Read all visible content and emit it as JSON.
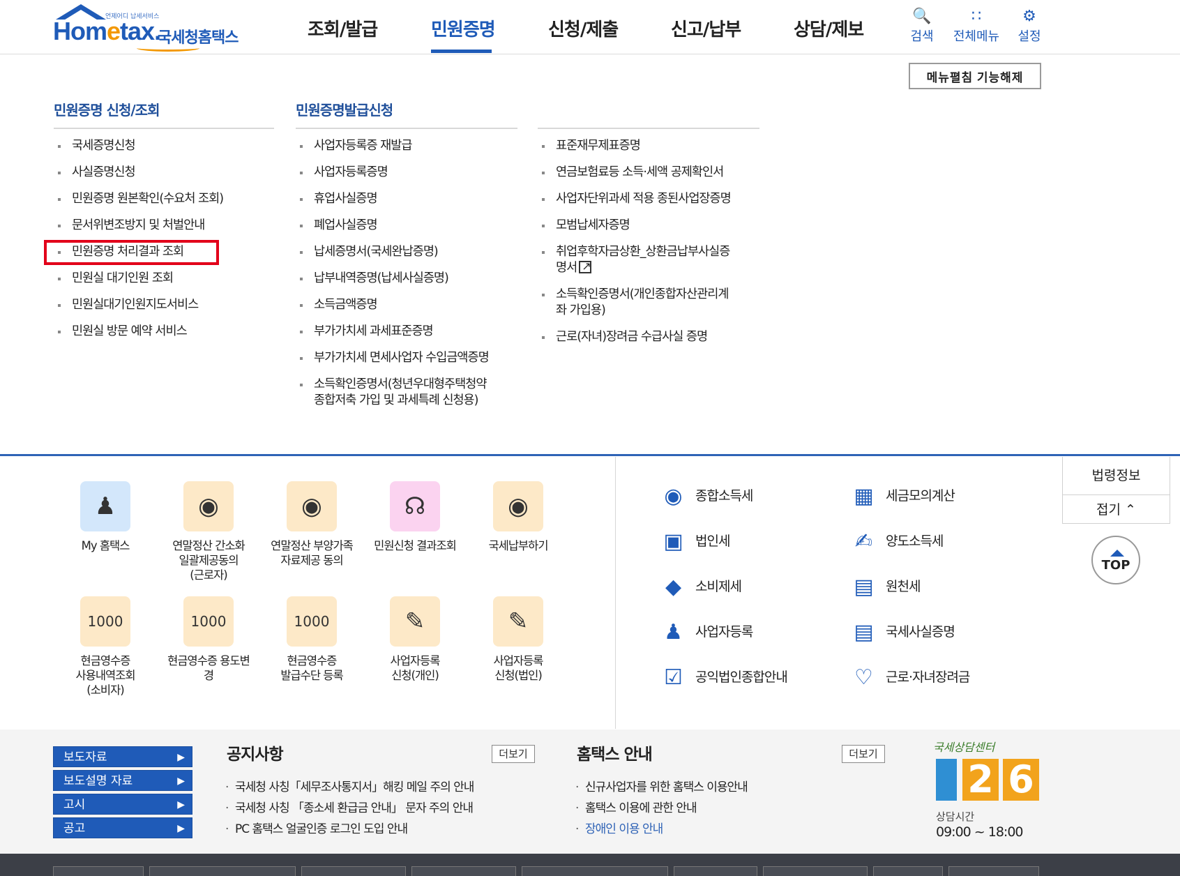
{
  "header": {
    "logo_tag": "언제어디 납세서비스",
    "logo_word_a": "Hom",
    "logo_word_b": "e",
    "logo_word_c": "tax",
    "logo_word_dot": ".",
    "logo_korean": "국세청홈택스",
    "nav": [
      {
        "label": "조회/발급",
        "active": false
      },
      {
        "label": "민원증명",
        "active": true
      },
      {
        "label": "신청/제출",
        "active": false
      },
      {
        "label": "신고/납부",
        "active": false
      },
      {
        "label": "상담/제보",
        "active": false
      }
    ],
    "utils": [
      {
        "label": "검색",
        "icon": "search-icon"
      },
      {
        "label": "전체메뉴",
        "icon": "grid-icon"
      },
      {
        "label": "설정",
        "icon": "gear-icon"
      }
    ],
    "fold_button": "메뉴펼침 기능해제"
  },
  "megamenu": {
    "col1_title": "민원증명 신청/조회",
    "col2_title": "민원증명발급신청",
    "col1": [
      "국세증명신청",
      "사실증명신청",
      "민원증명 원본확인(수요처 조회)",
      "문서위변조방지 및 처벌안내",
      "민원증명 처리결과 조회",
      "민원실 대기인원 조회",
      "민원실대기인원지도서비스",
      "민원실 방문 예약 서비스"
    ],
    "col2": [
      "사업자등록증 재발급",
      "사업자등록증명",
      "휴업사실증명",
      "폐업사실증명",
      "납세증명서(국세완납증명)",
      "납부내역증명(납세사실증명)",
      "소득금액증명",
      "부가가치세 과세표준증명",
      "부가가치세 면세사업자 수입금액증명",
      "소득확인증명서(청년우대형주택청약",
      "종합저축 가입 및 과세특례 신청용)"
    ],
    "col3": [
      "표준재무제표증명",
      "연금보험료등 소득·세액 공제확인서",
      "사업자단위과세 적용 종된사업장증명",
      "모범납세자증명",
      "취업후학자금상환_상환금납부사실증",
      "명서",
      "소득확인증명서(개인종합자산관리계",
      "좌 가입용)",
      "근로(자녀)장려금 수급사실 증명"
    ]
  },
  "quick": [
    {
      "label": "My 홈택스",
      "icon": "user-icon"
    },
    {
      "label": "연말정산 간소화 일괄제공동의 (근로자)",
      "icon": "moneybag-icon"
    },
    {
      "label": "연말정산 부양가족 자료제공 동의",
      "icon": "moneybag-icon"
    },
    {
      "label": "민원신청 결과조회",
      "icon": "headset-icon"
    },
    {
      "label": "국세납부하기",
      "icon": "moneybag-icon"
    },
    {
      "label": "현금영수증 사용내역조회 (소비자)",
      "icon": "receipt-icon"
    },
    {
      "label": "현금영수증 용도변경",
      "icon": "receipt-icon"
    },
    {
      "label": "현금영수증 발급수단 등록",
      "icon": "receipt-icon"
    },
    {
      "label": "사업자등록 신청(개인)",
      "icon": "register-icon"
    },
    {
      "label": "사업자등록 신청(법인)",
      "icon": "register-icon"
    }
  ],
  "quick_label_lines": [
    [
      "My 홈택스"
    ],
    [
      "연말정산 간소화",
      "일괄제공동의",
      "(근로자)"
    ],
    [
      "연말정산 부양가족",
      "자료제공 동의"
    ],
    [
      "민원신청 결과조회"
    ],
    [
      "국세납부하기"
    ],
    [
      "현금영수증",
      "사용내역조회",
      "(소비자)"
    ],
    [
      "현금영수증 용도변",
      "경"
    ],
    [
      "현금영수증",
      "발급수단 등록"
    ],
    [
      "사업자등록",
      "신청(개인)"
    ],
    [
      "사업자등록",
      "신청(법인)"
    ]
  ],
  "tax_links": [
    {
      "label": "종합소득세",
      "icon": "money-sack-icon"
    },
    {
      "label": "세금모의계산",
      "icon": "calculator-icon"
    },
    {
      "label": "법인세",
      "icon": "building-icon"
    },
    {
      "label": "양도소득세",
      "icon": "document-pen-icon"
    },
    {
      "label": "소비제세",
      "icon": "diamond-icon"
    },
    {
      "label": "원천세",
      "icon": "salary-doc-icon"
    },
    {
      "label": "사업자등록",
      "icon": "person-icon"
    },
    {
      "label": "국세사실증명",
      "icon": "document-icon"
    },
    {
      "label": "공익법인종합안내",
      "icon": "clipboard-check-icon"
    },
    {
      "label": "근로·자녀장려금",
      "icon": "heart-hands-icon"
    }
  ],
  "side": {
    "law": "법령정보",
    "fold": "접기",
    "top": "TOP"
  },
  "footer": {
    "press": [
      "보도자료",
      "보도설명 자료",
      "고시",
      "공고"
    ],
    "notice_title": "공지사항",
    "guide_title": "홈택스 안내",
    "more": "더보기",
    "notices": [
      "국세청 사칭「세무조사통지서」해킹 메일 주의 안내",
      "국세청 사칭 「종소세 환급금 안내」 문자 주의 안내",
      "PC 홈택스 얼굴인증 로그인 도입 안내"
    ],
    "guides": [
      "신규사업자를 위한 홈택스 이용안내",
      "홈택스 이용에 관한 안내",
      "장애인 이용 안내"
    ],
    "call_sub": "국세상담센터",
    "call_num": "126",
    "call_hours_label": "상담시간",
    "call_hours": "09:00 ~ 18:00"
  },
  "colors": {
    "brand": "#1f5bb8",
    "highlight": "#e2001a",
    "accent": "#f39800"
  }
}
